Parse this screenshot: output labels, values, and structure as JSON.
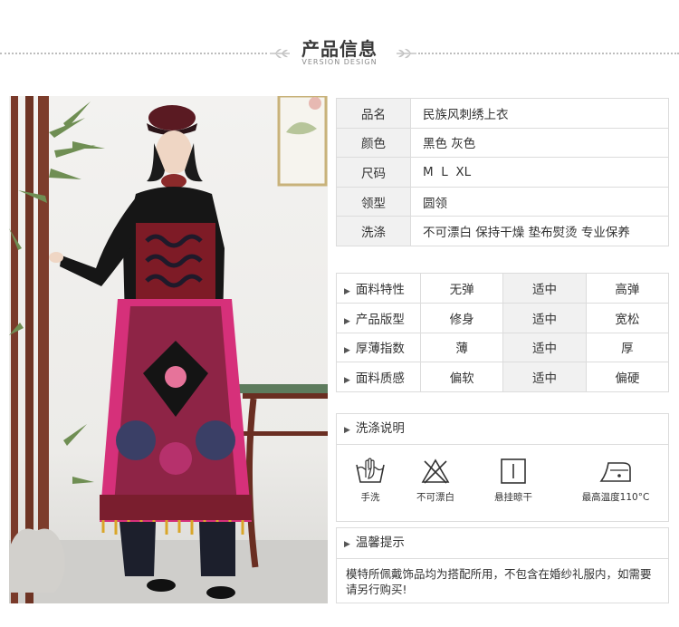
{
  "header": {
    "title": "产品信息",
    "subtitle": "VERSION DESIGN"
  },
  "product_info": [
    {
      "label": "品名",
      "value": "民族风刺绣上衣"
    },
    {
      "label": "颜色",
      "value": "黑色 灰色"
    },
    {
      "label": "尺码",
      "value": "M  L  XL"
    },
    {
      "label": "领型",
      "value": "圆领"
    },
    {
      "label": "洗涤",
      "value": "不可漂白 保持干燥 垫布熨烫 专业保养"
    }
  ],
  "attributes": [
    {
      "label": "面料特性",
      "options": [
        "无弹",
        "适中",
        "高弹"
      ],
      "selected_index": 1
    },
    {
      "label": "产品版型",
      "options": [
        "修身",
        "适中",
        "宽松"
      ],
      "selected_index": 1
    },
    {
      "label": "厚薄指数",
      "options": [
        "薄",
        "适中",
        "厚"
      ],
      "selected_index": 1
    },
    {
      "label": "面料质感",
      "options": [
        "偏软",
        "适中",
        "偏硬"
      ],
      "selected_index": 1
    }
  ],
  "care": {
    "title": "洗涤说明",
    "items": [
      {
        "icon": "hand-wash-icon",
        "label": "手洗"
      },
      {
        "icon": "no-bleach-icon",
        "label": "不可漂白"
      },
      {
        "icon": "hang-dry-icon",
        "label": "悬挂晾干"
      },
      {
        "icon": "iron-icon",
        "label": "最高温度110°C"
      }
    ]
  },
  "notice": {
    "title": "温馨提示",
    "text": "模特所佩戴饰品均为搭配所用，不包含在婚纱礼服内，如需要请另行购买!"
  },
  "colors": {
    "border": "#dcdcdc",
    "label_bg": "#f1f1f1",
    "text": "#333333"
  }
}
